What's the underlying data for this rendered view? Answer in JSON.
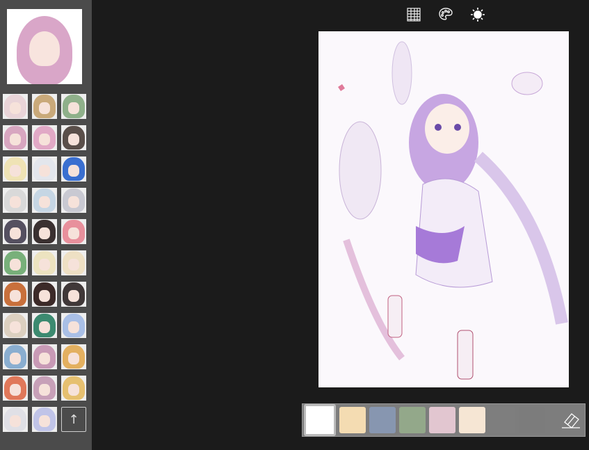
{
  "sidebar": {
    "preview_colors": {
      "hair": "#d9a6c8",
      "bg": "#ffffff"
    },
    "thumbnails": [
      "#e9d4d8",
      "#c9a97a",
      "#8fb08a",
      "#d8a6c0",
      "#e1a9c6",
      "#5a4f4a",
      "#efe3b5",
      "#e3e6ec",
      "#3a6fd0",
      "#d9d9d9",
      "#c6d6e4",
      "#c9c9d2",
      "#555060",
      "#3a3030",
      "#e8909c",
      "#78b07a",
      "#ece3c0",
      "#eee0c4",
      "#c8703c",
      "#3c2a28",
      "#403838",
      "#dcd0c0",
      "#3c8a70",
      "#a9bfe6",
      "#8aaed0",
      "#c89ab6",
      "#e3b060",
      "#e0785a",
      "#c7a0b8",
      "#e6c070",
      "#e0e0e6",
      "#c0c4e8"
    ],
    "upload_icon": "upload-file-icon"
  },
  "toolbar": {
    "icons": [
      "grid-icon",
      "palette-icon",
      "brightness-icon"
    ]
  },
  "palette": {
    "colors": [
      "#ffffff",
      "#f4dcb2",
      "#8796b0",
      "#93a88a",
      "#e2c6d0",
      "#f6e6d4",
      "#7e7e7e",
      "#7c7c7c"
    ],
    "selected": 0,
    "eraser_icon": "eraser-icon"
  }
}
